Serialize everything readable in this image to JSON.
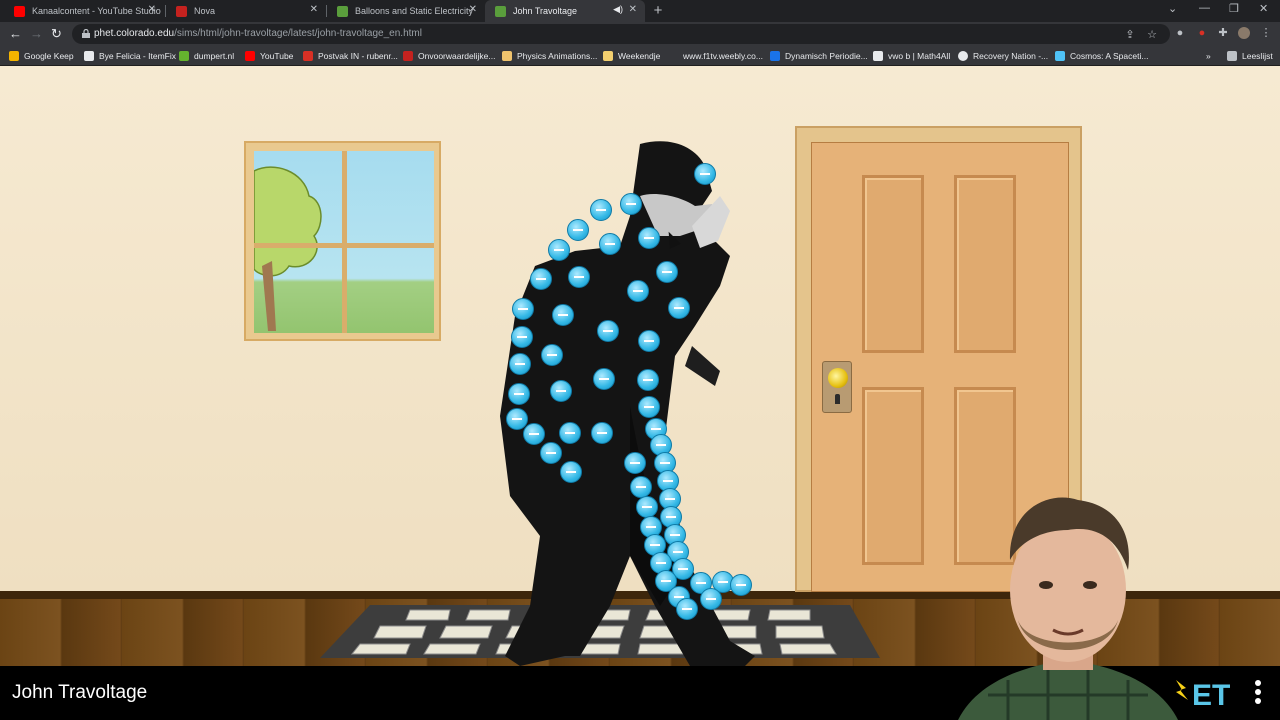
{
  "browser": {
    "tabs": [
      {
        "label": "Kanaalcontent - YouTube Studio",
        "favicon_color": "#ff0000",
        "active": false
      },
      {
        "label": "Nova",
        "favicon_color": "#c5221f",
        "active": false
      },
      {
        "label": "Balloons and Static Electricity",
        "favicon_color": "#5a9e3c",
        "active": false
      },
      {
        "label": "John Travoltage",
        "favicon_color": "#5a9e3c",
        "active": true
      }
    ],
    "new_tab_glyph": "+",
    "url_host": "phet.colorado.edu",
    "url_path": "/sims/html/john-travoltage/latest/john-travoltage_en.html",
    "bookmarks": [
      {
        "label": "Google Keep",
        "icon": "keep-icon",
        "color": "#f4b400"
      },
      {
        "label": "Bye Felicia - ItemFix",
        "icon": "itemfix-icon",
        "color": "#e8eaed"
      },
      {
        "label": "dumpert.nl",
        "icon": "dumpert-icon",
        "color": "#65b32e"
      },
      {
        "label": "YouTube",
        "icon": "youtube-icon",
        "color": "#ff0000"
      },
      {
        "label": "Postvak IN - rubenr...",
        "icon": "gmail-icon",
        "color": "#d93025"
      },
      {
        "label": "Onvoorwaardelijke...",
        "icon": "bookmark-icon",
        "color": "#c5221f"
      },
      {
        "label": "Physics Animations...",
        "icon": "physics-icon",
        "color": "#f0c36d"
      },
      {
        "label": "Weekendje",
        "icon": "folder-icon",
        "color": "#f4d06f"
      },
      {
        "label": "www.f1tv.weebly.co...",
        "icon": "",
        "color": ""
      },
      {
        "label": "Dynamisch Periodie...",
        "icon": "periodic-icon",
        "color": "#1a73e8"
      },
      {
        "label": "vwo b | Math4All",
        "icon": "math4all-icon",
        "color": "#e8eaed"
      },
      {
        "label": "Recovery Nation -...",
        "icon": "globe-icon",
        "color": "#e8eaed"
      },
      {
        "label": "Cosmos: A Spaceti...",
        "icon": "cosmos-icon",
        "color": "#4fc3f7"
      }
    ],
    "more_bookmarks_glyph": "»",
    "reading_list_label": "Leeslijst"
  },
  "sim": {
    "title": "John Travoltage",
    "electron_color": "#33b8e6",
    "wall_color": "#f3e6cc",
    "door_color": "#e6b278",
    "floor_color": "#6b4414"
  }
}
